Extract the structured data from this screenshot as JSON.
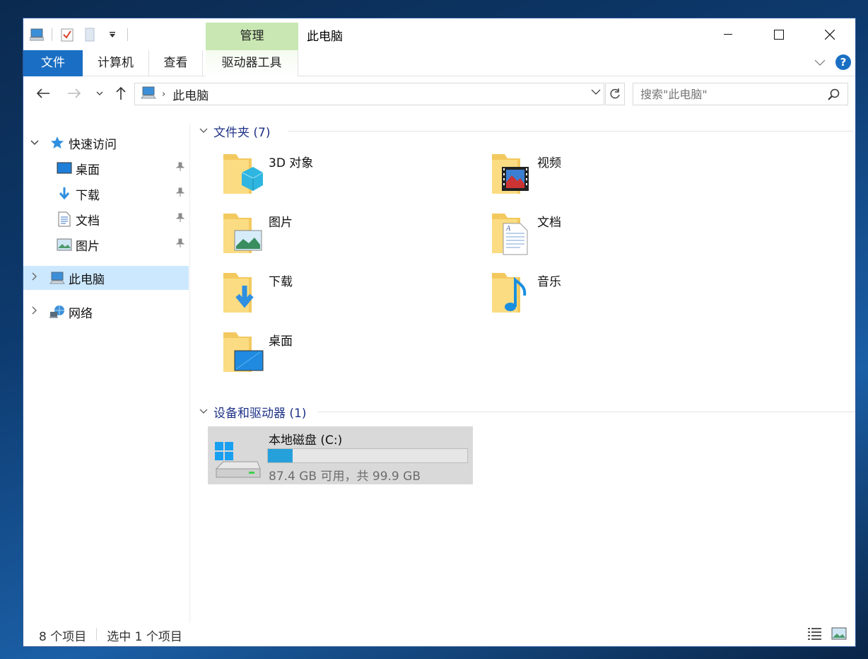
{
  "window": {
    "title": "此电脑",
    "manage_tab": "管理"
  },
  "ribbon": {
    "tabs": [
      "文件",
      "计算机",
      "查看",
      "驱动器工具"
    ]
  },
  "address": {
    "path": "此电脑",
    "search_placeholder": "搜索\"此电脑\""
  },
  "nav": {
    "quick_access": "快速访问",
    "quick_items": [
      "桌面",
      "下载",
      "文档",
      "图片"
    ],
    "this_pc": "此电脑",
    "network": "网络"
  },
  "folders_group": {
    "header": "文件夹 (7)",
    "items": [
      "3D 对象",
      "视频",
      "图片",
      "文档",
      "下载",
      "音乐",
      "桌面"
    ]
  },
  "drives_group": {
    "header": "设备和驱动器 (1)",
    "drive": {
      "label": "本地磁盘 (C:)",
      "space_text": "87.4 GB 可用，共 99.9 GB",
      "used_fraction": 0.125
    }
  },
  "status": {
    "item_count": "8 个项目",
    "selected": "选中 1 个项目"
  },
  "colors": {
    "accent": "#1a6fc4",
    "manage_tab": "#c8e7b2",
    "selection": "#cce8ff",
    "drive_bar": "#26a0da"
  }
}
